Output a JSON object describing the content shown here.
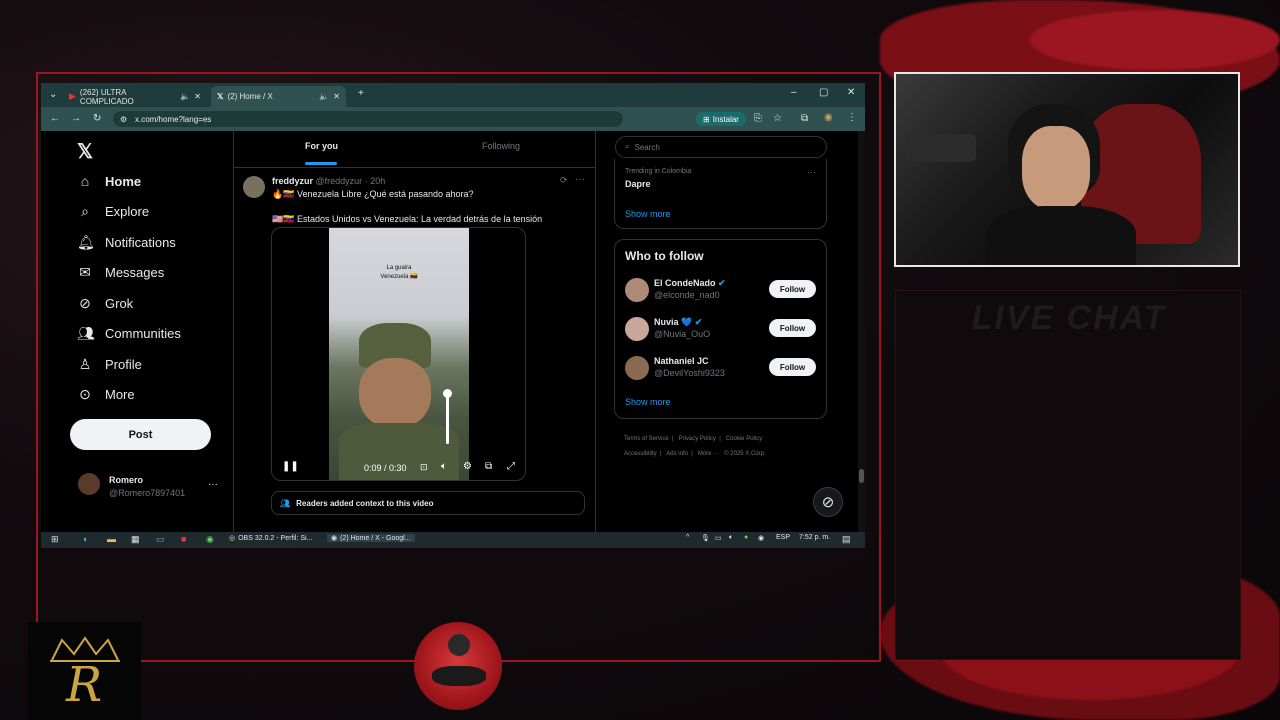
{
  "browser": {
    "tabs": [
      {
        "label": "(262) ULTRA COMPLICADO"
      },
      {
        "label": "(2) Home / X"
      }
    ],
    "url": "x.com/home?lang=es",
    "install_label": "Instalar"
  },
  "nav": {
    "items": [
      {
        "label": "Home",
        "icon": "home-icon"
      },
      {
        "label": "Explore",
        "icon": "search-icon"
      },
      {
        "label": "Notifications",
        "icon": "bell-icon"
      },
      {
        "label": "Messages",
        "icon": "mail-icon"
      },
      {
        "label": "Grok",
        "icon": "grok-icon"
      },
      {
        "label": "Communities",
        "icon": "people-icon"
      },
      {
        "label": "Profile",
        "icon": "person-icon"
      },
      {
        "label": "More",
        "icon": "more-circle-icon"
      }
    ],
    "post_label": "Post",
    "account": {
      "name": "Romero",
      "handle": "@Romero7897401"
    }
  },
  "feed": {
    "tabs": [
      "For you",
      "Following"
    ],
    "tweet": {
      "author": "freddyzur",
      "handle": "@freddyzur",
      "time": "· 20h",
      "text": "Venezuela Libre ¿Qué está pasando ahora?",
      "subtext": "Estados Unidos vs Venezuela: La verdad detrás de la tensión",
      "video_caption_line1": "La guaira",
      "video_caption_line2": "Venezuela",
      "video_time": "0:09 / 0:30",
      "context_label": "Readers added context to this video"
    }
  },
  "sidebar_right": {
    "search_placeholder": "Search",
    "trending_label": "Trending in Colombia",
    "trending_topic": "Dapre",
    "show_more": "Show more",
    "who_to_follow_title": "Who to follow",
    "suggestions": [
      {
        "name": "El CondeNado",
        "handle": "@elconde_nad0",
        "follow": "Follow"
      },
      {
        "name": "Nuvia 💙",
        "handle": "@Nuvia_OuO",
        "follow": "Follow"
      },
      {
        "name": "Nathaniel JC",
        "handle": "@DevilYoshi9323",
        "follow": "Follow"
      }
    ],
    "show_more_2": "Show more",
    "footer_links": [
      "Terms of Service",
      "Privacy Policy",
      "Cookie Policy",
      "Accessibility",
      "Ads info",
      "More ···",
      "© 2025 X Corp."
    ]
  },
  "taskbar": {
    "obs_label": "OBS 32.0.2 - Perfil: Si...",
    "chrome_label": "(2) Home / X - Googl...",
    "lang": "ESP",
    "time": "7:52 p. m."
  },
  "overlay": {
    "live_chat_title": "LIVE CHAT"
  },
  "colors": {
    "accent_red": "#9b1620",
    "x_bg": "#000000",
    "tab_teal": "#2f5250",
    "verified_blue": "#1d9bf0"
  }
}
